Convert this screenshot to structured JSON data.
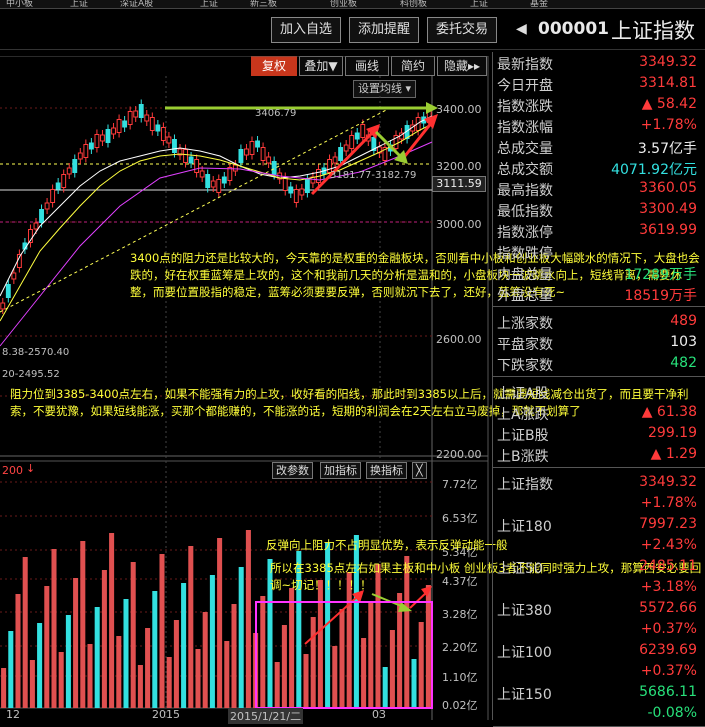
{
  "tabstrip": [
    "中小板",
    "上证",
    "深证A股",
    "上证",
    "新三板",
    "创业板",
    "科创板",
    "上证",
    "基金"
  ],
  "header": {
    "buttons": [
      "加入自选",
      "添加提醒",
      "委托交易"
    ],
    "code": "000001",
    "name": "上证指数"
  },
  "toolbar": {
    "buttons": [
      "复权",
      "叠加▼",
      "画线",
      "简约",
      "隐藏▸▸"
    ],
    "ma_setting": "设置均线 ▾"
  },
  "chart": {
    "y_axis_labels": [
      "3400.00",
      "3200.00",
      "3000.00",
      "2600.00",
      "2200.00"
    ],
    "current_price": "3111.59",
    "high_marker": "3406.79",
    "range_label": "3181.77-3182.79",
    "low_range": "8.38-2570.40",
    "low_range2": "20-2495.52",
    "vol_title": "200",
    "vol_y_labels": [
      "7.72亿",
      "6.53亿",
      "5.34亿",
      "4.37亿",
      "3.28亿",
      "2.20亿",
      "1.10亿",
      "0.02亿"
    ],
    "x_labels": [
      "12",
      "2015",
      "2015/1/21/二",
      "03"
    ],
    "vol_buttons": [
      "改参数",
      "加指标",
      "换指标",
      "╳"
    ],
    "annotation1": "3400点的阻力还是比较大的，今天靠的是权重的金融板块，否则看中小板和创业板大幅跳水的情况下，大盘也会跌的，好在权重蓝筹是上攻的，这个和我前几天的分析是温和的，小盘板块一波跳水向上，短线背离，需要休整，而要位置股指的稳定，蓝筹必须要要反弹，否则就沉下去了，还好，蓝筹没有死~",
    "annotation2": "阻力位到3385-3400点左右，如果不能强有力的上攻，收好看的阳线，那此时到3385以上后，就需要短线减仓出货了，而且要干净利索，不要犹豫，如果短线能涨，买那个都能赚的，不能涨的话，短期的利润会在2天左右立马废掉，那就不划算了",
    "annotation3": "反弹向上阻力不占明显优势，表示反弹动能一般",
    "annotation4": "所以在3385点左右如果主板和中小板 创业板3者不能同时强力上攻，那算西安必要回调~切记！！！！！"
  },
  "panel": {
    "rows1": [
      {
        "label": "最新指数",
        "value": "3349.32",
        "color": "red"
      },
      {
        "label": "今日开盘",
        "value": "3314.81",
        "color": "red"
      },
      {
        "label": "指数涨跌",
        "value": "▲ 58.42",
        "color": "red"
      },
      {
        "label": "指数涨幅",
        "value": "+1.78%",
        "color": "red"
      },
      {
        "label": "总成交量",
        "value": "3.57亿手",
        "color": "white"
      },
      {
        "label": "总成交额",
        "value": "4071.92亿元",
        "color": "cyan"
      },
      {
        "label": "最高指数",
        "value": "3360.05",
        "color": "red"
      },
      {
        "label": "最低指数",
        "value": "3300.49",
        "color": "red"
      },
      {
        "label": "指数涨停",
        "value": "3619.99",
        "color": "red"
      },
      {
        "label": "指数跌停",
        "value": "",
        "color": "green"
      },
      {
        "label": "内盘总量",
        "value": "17289万手",
        "color": "green"
      },
      {
        "label": "外盘总量",
        "value": "18519万手",
        "color": "red"
      }
    ],
    "rows2": [
      {
        "label": "上涨家数",
        "value": "489",
        "color": "red"
      },
      {
        "label": "平盘家数",
        "value": "103",
        "color": "white"
      },
      {
        "label": "下跌家数",
        "value": "482",
        "color": "green"
      }
    ],
    "rows3": [
      {
        "label": "上证A股",
        "value": "",
        "color": "red"
      },
      {
        "label": "上A涨跌",
        "value": "▲ 61.38",
        "color": "red"
      },
      {
        "label": "上证B股",
        "value": "299.19",
        "color": "red"
      },
      {
        "label": "上B涨跌",
        "value": "▲ 1.29",
        "color": "red"
      }
    ],
    "rows4": [
      {
        "label": "上证指数",
        "value": "3349.32",
        "color": "red"
      },
      {
        "label": "",
        "value": "+1.78%",
        "color": "red"
      },
      {
        "label": "上证180",
        "value": "7997.23",
        "color": "red"
      },
      {
        "label": "",
        "value": "+2.43%",
        "color": "red"
      },
      {
        "label": "上证50",
        "value": "2485.11",
        "color": "red"
      },
      {
        "label": "",
        "value": "+3.18%",
        "color": "red"
      },
      {
        "label": "上证380",
        "value": "5572.66",
        "color": "red"
      },
      {
        "label": "",
        "value": "+0.37%",
        "color": "red"
      },
      {
        "label": "上证100",
        "value": "6239.69",
        "color": "red"
      },
      {
        "label": "",
        "value": "+0.37%",
        "color": "red"
      },
      {
        "label": "上证150",
        "value": "5686.11",
        "color": "green"
      },
      {
        "label": "",
        "value": "-0.08%",
        "color": "green"
      }
    ]
  }
}
